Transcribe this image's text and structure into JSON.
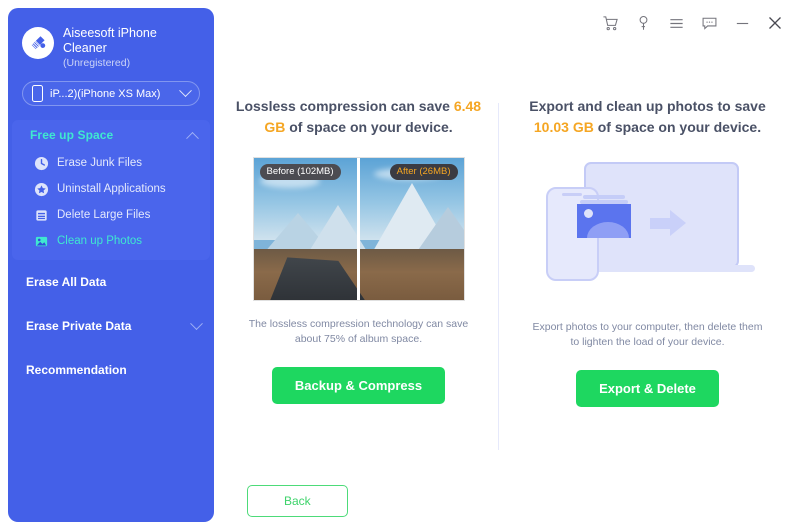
{
  "app": {
    "brand_name": "Aiseesoft iPhone Cleaner",
    "brand_status": "(Unregistered)",
    "logo_icon": "broom-cleaner-icon"
  },
  "device_selector": {
    "icon": "phone-icon",
    "label": "iP...2)(iPhone XS Max)",
    "chevron": "chevron-down-icon"
  },
  "titlebar": {
    "icons": [
      {
        "name": "cart-icon",
        "glyph": "cart"
      },
      {
        "name": "key-icon",
        "glyph": "key"
      },
      {
        "name": "menu-icon",
        "glyph": "menu"
      },
      {
        "name": "chat-icon",
        "glyph": "chat"
      },
      {
        "name": "minimize-icon",
        "glyph": "minimize"
      },
      {
        "name": "close-icon",
        "glyph": "close"
      }
    ]
  },
  "sidebar": {
    "free_up_space": {
      "label": "Free up Space",
      "expanded": true,
      "chevron": "chevron-up-icon",
      "items": [
        {
          "label": "Erase Junk Files",
          "icon": "clock-icon",
          "selected": false
        },
        {
          "label": "Uninstall Applications",
          "icon": "app-star-icon",
          "selected": false
        },
        {
          "label": "Delete Large Files",
          "icon": "file-list-icon",
          "selected": false
        },
        {
          "label": "Clean up Photos",
          "icon": "photo-icon",
          "selected": true
        }
      ]
    },
    "erase_all_data": {
      "label": "Erase All Data"
    },
    "erase_private_data": {
      "label": "Erase Private Data",
      "chevron": "chevron-down-icon"
    },
    "recommendation": {
      "label": "Recommendation"
    }
  },
  "main": {
    "left_panel": {
      "title_part1": "Lossless compression can save",
      "title_highlight": "6.48 GB",
      "title_part2": "of space on your device.",
      "image": {
        "before_tag": "Before (102MB)",
        "after_tag": "After (26MB)",
        "alt": "mountain-landscape-before-after"
      },
      "description": "The lossless compression technology can save about 75% of album space.",
      "button_label": "Backup & Compress"
    },
    "right_panel": {
      "title_part1": "Export and clean up photos to save",
      "title_highlight": "10.03 GB",
      "title_part2": "of space on your device.",
      "illustration": "phone-to-laptop-photo-transfer",
      "description": "Export photos to your computer, then delete them to lighten the load of your device.",
      "button_label": "Export & Delete"
    },
    "back_button_label": "Back"
  },
  "colors": {
    "sidebar_blue": "#4460E8",
    "accent_cyan": "#3FE8D0",
    "highlight_orange": "#F5A623",
    "button_green": "#1ED760",
    "body_text": "#8089a3"
  }
}
